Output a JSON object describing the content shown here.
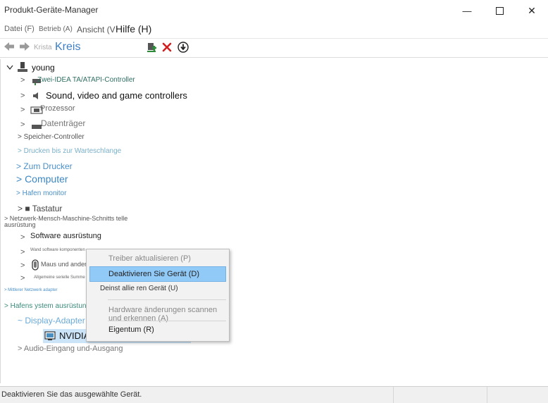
{
  "window": {
    "title": "Produkt-Geräte-Manager",
    "controls": {
      "minimize": "—",
      "close": "✕"
    }
  },
  "menubar": {
    "items": [
      "Datei (F)",
      "Betrieb (A)",
      "Ansicht (V",
      "Hilfe (H)"
    ]
  },
  "toolbar": {
    "faded_text": "Krista",
    "big_text": "Kreis"
  },
  "tree": {
    "root": {
      "label": "young",
      "chevron": "v"
    },
    "rows": [
      {
        "label": "Zwei-IDEA TA/ATAPI-Controller",
        "chevron": ">"
      },
      {
        "label": "Sound, video and game controllers",
        "chevron": ">"
      },
      {
        "label": "Prozessor",
        "chevron": ">"
      },
      {
        "label": "Datenträger",
        "chevron": ">"
      },
      {
        "label": "> Speicher-Controller"
      },
      {
        "label": "> Drucken bis zur Warteschlange"
      },
      {
        "label": "> Zum Drucker"
      },
      {
        "label": "> Computer"
      },
      {
        "label": "> Hafen monitor"
      },
      {
        "label": "> ■ Tastatur"
      },
      {
        "label": "> Netzwerk-Mensch-Maschine-Schnitts telle"
      },
      {
        "label": "ausrüstung"
      },
      {
        "label": "Software ausrüstung",
        "chevron": ">"
      },
      {
        "label": "Wand software komponenten",
        "chevron": ">"
      },
      {
        "label": "Maus und andere",
        "chevron": ">"
      },
      {
        "label": "Allgemeine serielle Summe",
        "chevron": ">"
      },
      {
        "label": "> Mittlerer Netzwerk adapter"
      },
      {
        "label": "> Hafens ystem ausrüstung"
      },
      {
        "label": "~ Display-Adapter"
      },
      {
        "label": "NVIDIA"
      },
      {
        "label": "> Audio-Eingang und-Ausgang"
      }
    ]
  },
  "context_menu": {
    "items": [
      {
        "label": "Treiber aktualisieren (P)"
      },
      {
        "label": "Deaktivieren Sie Gerät (D)"
      },
      {
        "label": "Deinst allie ren Gerät (U)"
      },
      {
        "label": "Hardware änderungen scannen und erkennen (A)"
      },
      {
        "label": "Eigentum (R)"
      }
    ]
  },
  "statusbar": {
    "text": "Deaktivieren Sie das ausgewählte Gerät."
  },
  "colors": {
    "accent_blue": "#3b7fc4",
    "light_blue": "#6aaad9",
    "teal": "#3a8a7a",
    "highlight": "#91c9f7",
    "delete_red": "#d21f1f",
    "add_green": "#2e8b3a"
  }
}
